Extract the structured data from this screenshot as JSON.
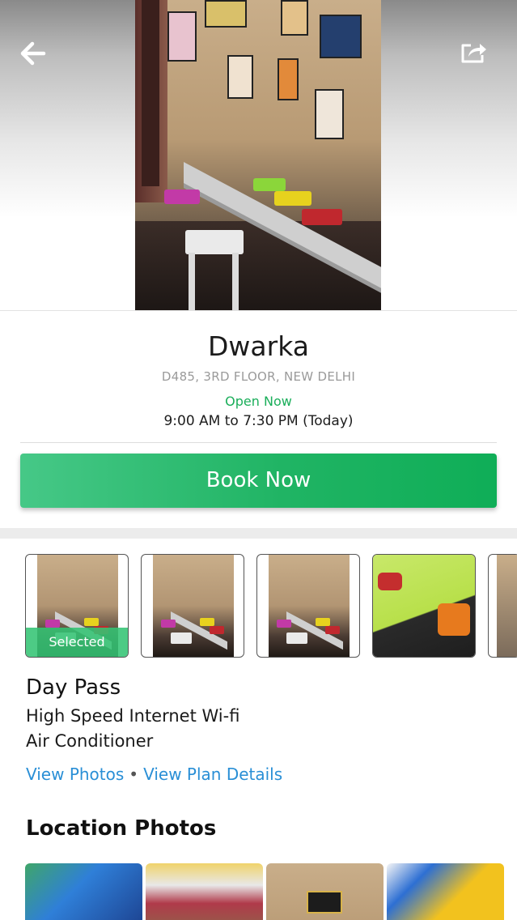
{
  "header": {
    "back_icon": "arrow-left-icon",
    "share_icon": "share-icon"
  },
  "location": {
    "name": "Dwarka",
    "address": "D485, 3RD FLOOR, NEW DELHI",
    "status": "Open Now",
    "hours": "9:00 AM to 7:30 PM (Today)"
  },
  "actions": {
    "book_label": "Book Now"
  },
  "plans": {
    "selected_label": "Selected",
    "thumbnails": [
      "plan-photo-1",
      "plan-photo-2",
      "plan-photo-3",
      "plan-photo-4",
      "plan-photo-5"
    ]
  },
  "plan": {
    "title": "Day Pass",
    "features": [
      "High Speed Internet Wi-fi",
      "Air Conditioner"
    ],
    "view_photos": "View Photos",
    "separator": "•",
    "view_details": "View Plan Details"
  },
  "location_photos": {
    "title": "Location Photos"
  },
  "colors": {
    "accent_green": "#1aae5a",
    "link_blue": "#2a8fd6",
    "button_green_start": "#46c887",
    "button_green_end": "#0fae57"
  }
}
